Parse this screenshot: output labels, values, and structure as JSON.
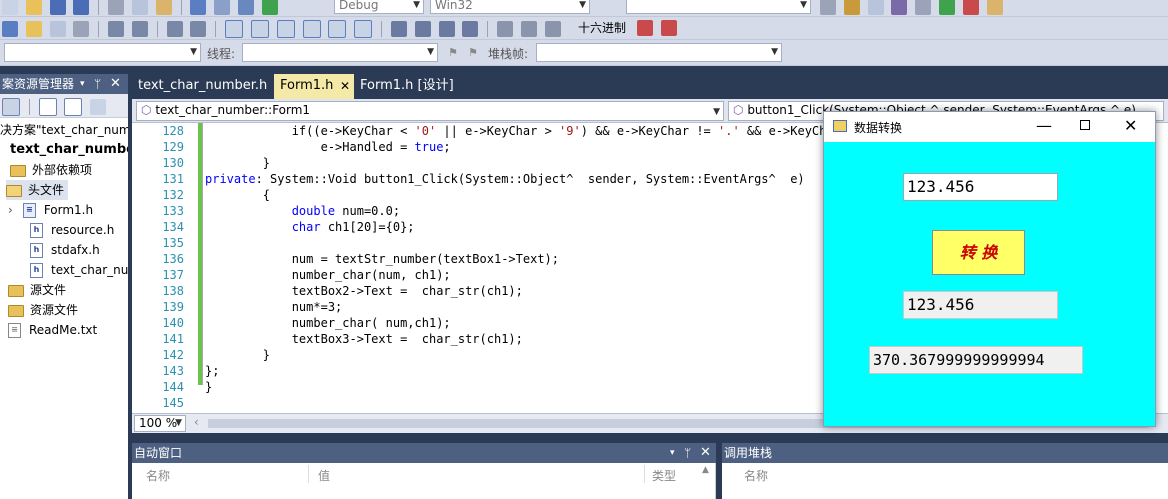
{
  "toolbar": {
    "config": "Debug",
    "platform": "Win32",
    "hex_label": "十六进制",
    "thread_label": "线程:",
    "stack_frame_label": "堆栈帧:"
  },
  "solution_explorer": {
    "title": "案资源管理器",
    "items": [
      {
        "label": "决方案\"text_char_num",
        "kind": "solution"
      },
      {
        "label": "text_char_number",
        "kind": "project"
      },
      {
        "label": "外部依赖项",
        "kind": "folder"
      },
      {
        "label": "头文件",
        "kind": "folder-open"
      },
      {
        "label": "Form1.h",
        "kind": "file"
      },
      {
        "label": "resource.h",
        "kind": "file"
      },
      {
        "label": "stdafx.h",
        "kind": "file"
      },
      {
        "label": "text_char_num",
        "kind": "file"
      },
      {
        "label": "源文件",
        "kind": "folder"
      },
      {
        "label": "资源文件",
        "kind": "folder"
      },
      {
        "label": "ReadMe.txt",
        "kind": "file"
      }
    ]
  },
  "tabs": [
    {
      "label": "text_char_number.h"
    },
    {
      "label": "Form1.h"
    },
    {
      "label": "Form1.h [设计]"
    }
  ],
  "editor": {
    "class_combo": "text_char_number::Form1",
    "member_combo": "button1_Click(System::Object ^ sender, System::EventArgs ^ e)",
    "zoom": "100 %",
    "lines": [
      {
        "n": "128",
        "text": "            if((e->KeyChar < '0' || e->KeyChar > '9') && e->KeyChar != '.' && e->KeyChar"
      },
      {
        "n": "129",
        "text": "                e->Handled = true;"
      },
      {
        "n": "130",
        "text": "        }"
      },
      {
        "n": "131",
        "text": "private: System::Void button1_Click(System::Object^  sender, System::EventArgs^  e)"
      },
      {
        "n": "132",
        "text": "        {"
      },
      {
        "n": "133",
        "text": "            double num=0.0;"
      },
      {
        "n": "134",
        "text": "            char ch1[20]={0};"
      },
      {
        "n": "135",
        "text": ""
      },
      {
        "n": "136",
        "text": "            num = textStr_number(textBox1->Text);"
      },
      {
        "n": "137",
        "text": "            number_char(num, ch1);"
      },
      {
        "n": "138",
        "text": "            textBox2->Text =  char_str(ch1);"
      },
      {
        "n": "139",
        "text": "            num*=3;"
      },
      {
        "n": "140",
        "text": "            number_char( num,ch1);"
      },
      {
        "n": "141",
        "text": "            textBox3->Text =  char_str(ch1);"
      },
      {
        "n": "142",
        "text": "        }"
      },
      {
        "n": "143",
        "text": "};"
      },
      {
        "n": "144",
        "text": "}"
      },
      {
        "n": "145",
        "text": ""
      },
      {
        "n": "146",
        "text": ""
      }
    ]
  },
  "autos": {
    "title": "自动窗口",
    "col_name": "名称",
    "col_value": "值",
    "col_type": "类型"
  },
  "callstack": {
    "title": "调用堆栈",
    "col_name": "名称"
  },
  "dialog": {
    "title": "数据转换",
    "textbox1": "123.456",
    "button": "转 换",
    "textbox2": "123.456",
    "textbox3": "370.367999999999994",
    "bg_color": "#00ffff"
  }
}
